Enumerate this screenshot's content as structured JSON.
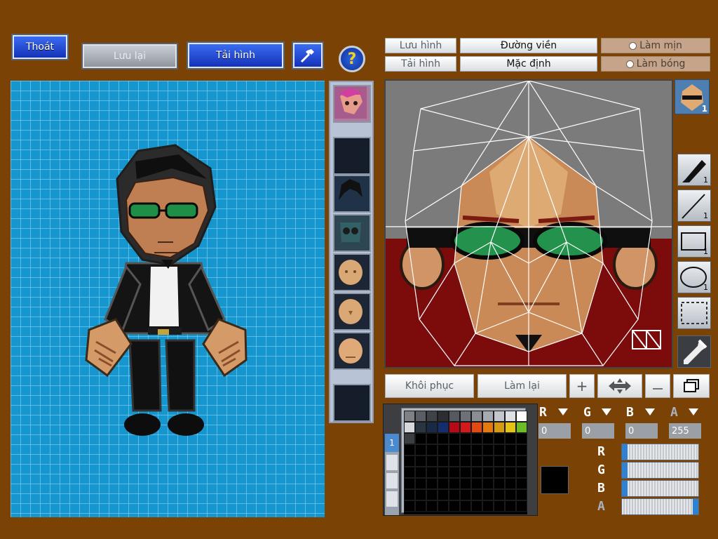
{
  "toolbar": {
    "exit_label": "Thoát",
    "save_label": "Lưu lại",
    "load_label": "Tải hình",
    "help_glyph": "?"
  },
  "editor": {
    "save_image_label": "Lưu hình",
    "load_image_label": "Tải hình",
    "outline_label": "Đường viền",
    "default_label": "Mặc định",
    "smooth_label": "Làm mịn",
    "shade_label": "Làm bóng",
    "preview_badge": "1",
    "restore_label": "Khôi phục",
    "redo_label": "Làm lại",
    "plus_glyph": "+"
  },
  "tools": [
    {
      "name": "pen-tool",
      "icon": "pen-icon",
      "count": "1"
    },
    {
      "name": "line-tool",
      "icon": "line-icon",
      "count": "1"
    },
    {
      "name": "rect-tool",
      "icon": "rectangle-icon",
      "count": "1"
    },
    {
      "name": "ellipse-tool",
      "icon": "ellipse-icon",
      "count": "1"
    },
    {
      "name": "select-tool",
      "icon": "selection-icon",
      "count": ""
    },
    {
      "name": "eyedropper-tool",
      "icon": "eyedropper-icon",
      "count": ""
    }
  ],
  "color": {
    "r_label": "R",
    "g_label": "G",
    "b_label": "B",
    "a_label": "A",
    "r": "0",
    "g": "0",
    "b": "0",
    "a": "255",
    "r_fraction": 0,
    "g_fraction": 0,
    "b_fraction": 0,
    "a_fraction": 1,
    "current_hex": "#000000"
  },
  "palette": {
    "colors": [
      "#7e8187",
      "#5a5d63",
      "#3f4246",
      "#2b2d31",
      "#565a60",
      "#6e7278",
      "#8a8e94",
      "#a7abb1",
      "#c3c7cd",
      "#dde0e4",
      "#ffffff",
      "#d6d9de",
      "#2a3542",
      "#1a2a44",
      "#142d6e",
      "#b40b17",
      "#d21a1a",
      "#e14a12",
      "#e27a10",
      "#d49a12",
      "#e6c214",
      "#6bbd28",
      "#3a3d42"
    ],
    "tab_label": "1"
  },
  "colors": {
    "background": "#7a4204",
    "grid_blue": "#1596cf",
    "accent_blue": "#2f82d3"
  }
}
